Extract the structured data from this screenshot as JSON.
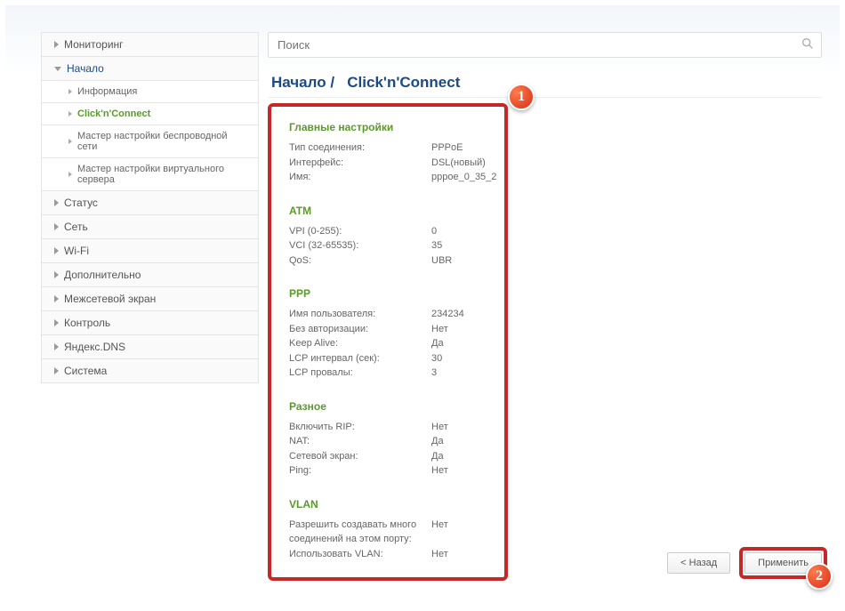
{
  "search": {
    "placeholder": "Поиск"
  },
  "sidebar": {
    "items": [
      {
        "label": "Мониторинг"
      },
      {
        "label": "Начало"
      },
      {
        "label": "Статус"
      },
      {
        "label": "Сеть"
      },
      {
        "label": "Wi-Fi"
      },
      {
        "label": "Дополнительно"
      },
      {
        "label": "Межсетевой экран"
      },
      {
        "label": "Контроль"
      },
      {
        "label": "Яндекс.DNS"
      },
      {
        "label": "Система"
      }
    ],
    "sub": [
      {
        "label": "Информация"
      },
      {
        "label": "Click'n'Connect"
      },
      {
        "label": "Мастер настройки беспроводной сети"
      },
      {
        "label": "Мастер настройки виртуального сервера"
      }
    ]
  },
  "breadcrumb": {
    "root": "Начало",
    "sep": "/",
    "current": "Click'n'Connect"
  },
  "sections": {
    "main": {
      "title": "Главные настройки",
      "rows": [
        {
          "k": "Тип соединения:",
          "v": "PPPoE"
        },
        {
          "k": "Интерфейс:",
          "v": "DSL(новый)"
        },
        {
          "k": "Имя:",
          "v": "pppoe_0_35_2"
        }
      ]
    },
    "atm": {
      "title": "ATM",
      "rows": [
        {
          "k": "VPI (0-255):",
          "v": "0"
        },
        {
          "k": "VCI (32-65535):",
          "v": "35"
        },
        {
          "k": "QoS:",
          "v": "UBR"
        }
      ]
    },
    "ppp": {
      "title": "PPP",
      "rows": [
        {
          "k": "Имя пользователя:",
          "v": "234234"
        },
        {
          "k": "Без авторизации:",
          "v": "Нет"
        },
        {
          "k": "Keep Alive:",
          "v": "Да"
        },
        {
          "k": "LCP интервал (сек):",
          "v": "30"
        },
        {
          "k": "LCP провалы:",
          "v": "3"
        }
      ]
    },
    "misc": {
      "title": "Разное",
      "rows": [
        {
          "k": "Включить RIP:",
          "v": "Нет"
        },
        {
          "k": "NAT:",
          "v": "Да"
        },
        {
          "k": "Сетевой экран:",
          "v": "Да"
        },
        {
          "k": "Ping:",
          "v": "Нет"
        }
      ]
    },
    "vlan": {
      "title": "VLAN",
      "rows": [
        {
          "k": "Разрешить создавать много соединений на этом порту:",
          "v": "Нет"
        },
        {
          "k": "Использовать VLAN:",
          "v": "Нет"
        }
      ]
    }
  },
  "buttons": {
    "back": "< Назад",
    "apply": "Применить"
  },
  "badges": {
    "one": "1",
    "two": "2"
  }
}
